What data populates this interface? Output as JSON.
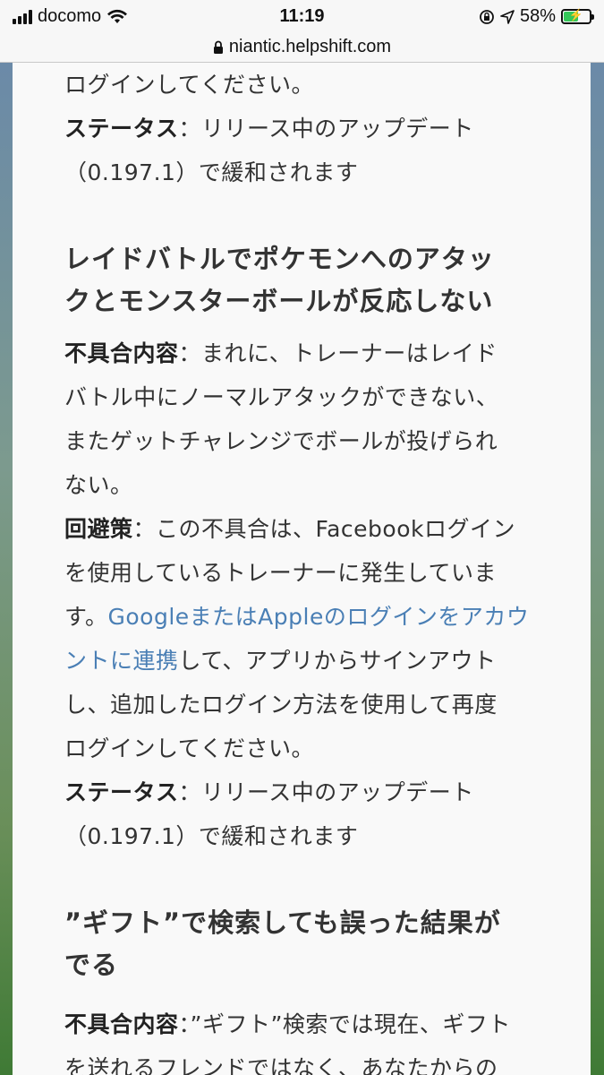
{
  "status_bar": {
    "carrier": "docomo",
    "time": "11:19",
    "battery_percent": "58%",
    "battery_level": 0.58
  },
  "url_bar": {
    "url": "niantic.helpshift.com"
  },
  "article": {
    "top_continuation": "ログインしてください。",
    "status_label": "ステータス",
    "status_text_1": "：リリース中のアップデート",
    "status_text_2": "（0.197.1）で緩和されます",
    "section1": {
      "title_1": "レイドバトルでポケモンへのアタッ",
      "title_2": "クとモンスターボールが反応しない",
      "issue_label": "不具合内容",
      "issue_lines": [
        "：まれに、トレーナーはレイド",
        "バトル中にノーマルアタックができない、",
        "またゲットチャレンジでボールが投げられ",
        "ない。"
      ],
      "workaround_label": "回避策",
      "workaround_line1": "：この不具合は、Facebookログイン",
      "workaround_line2": "を使用しているトレーナーに発生していま",
      "workaround_line3_pre": "す。",
      "link_part1": "GoogleまたはAppleのログインをアカウ",
      "link_part2": "ントに連携",
      "workaround_line4_post": "して、アプリからサインアウト",
      "workaround_line5": "し、追加したログイン方法を使用して再度",
      "workaround_line6": "ログインしてください。",
      "status_label": "ステータス",
      "status_text_1": "：リリース中のアップデート",
      "status_text_2": "（0.197.1）で緩和されます"
    },
    "section2": {
      "title_1": "”ギフト”で検索しても誤った結果が",
      "title_2": "でる",
      "issue_label": "不具合内容",
      "issue_line1": "：”ギフト”検索では現在、ギフト",
      "issue_line2": "を送れるフレンドではなく、あなたからの"
    }
  }
}
